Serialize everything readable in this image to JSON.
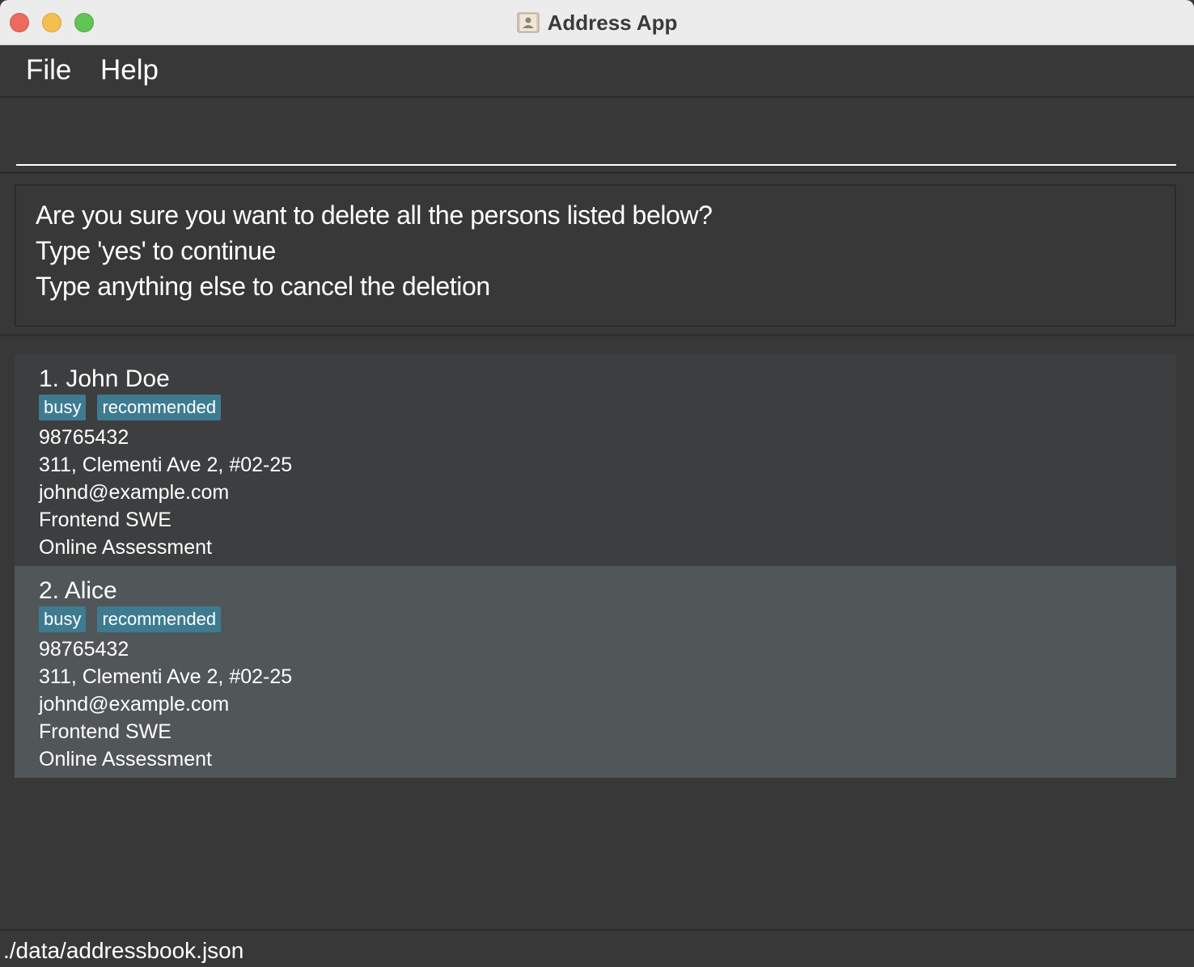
{
  "window": {
    "title": "Address App",
    "app_icon": "address-book-icon"
  },
  "menu": {
    "file": "File",
    "help": "Help"
  },
  "command": {
    "value": "",
    "placeholder": ""
  },
  "result": {
    "lines": [
      "Are you sure you want to delete all the persons listed below?",
      "Type 'yes' to continue",
      "Type anything else to cancel the deletion"
    ]
  },
  "persons": [
    {
      "name": "1. John Doe",
      "tags": [
        "busy",
        "recommended"
      ],
      "phone": "98765432",
      "address": "311, Clementi Ave 2, #02-25",
      "email": "johnd@example.com",
      "role": "Frontend SWE",
      "stage": "Online Assessment"
    },
    {
      "name": "2. Alice",
      "tags": [
        "busy",
        "recommended"
      ],
      "phone": "98765432",
      "address": "311, Clementi Ave 2, #02-25",
      "email": "johnd@example.com",
      "role": "Frontend SWE",
      "stage": "Online Assessment"
    }
  ],
  "status": {
    "path": "./data/addressbook.json"
  },
  "colors": {
    "background": "#383838",
    "tag": "#3e7b91",
    "card_selected": "#515658",
    "card_default": "#3c3e3f"
  }
}
